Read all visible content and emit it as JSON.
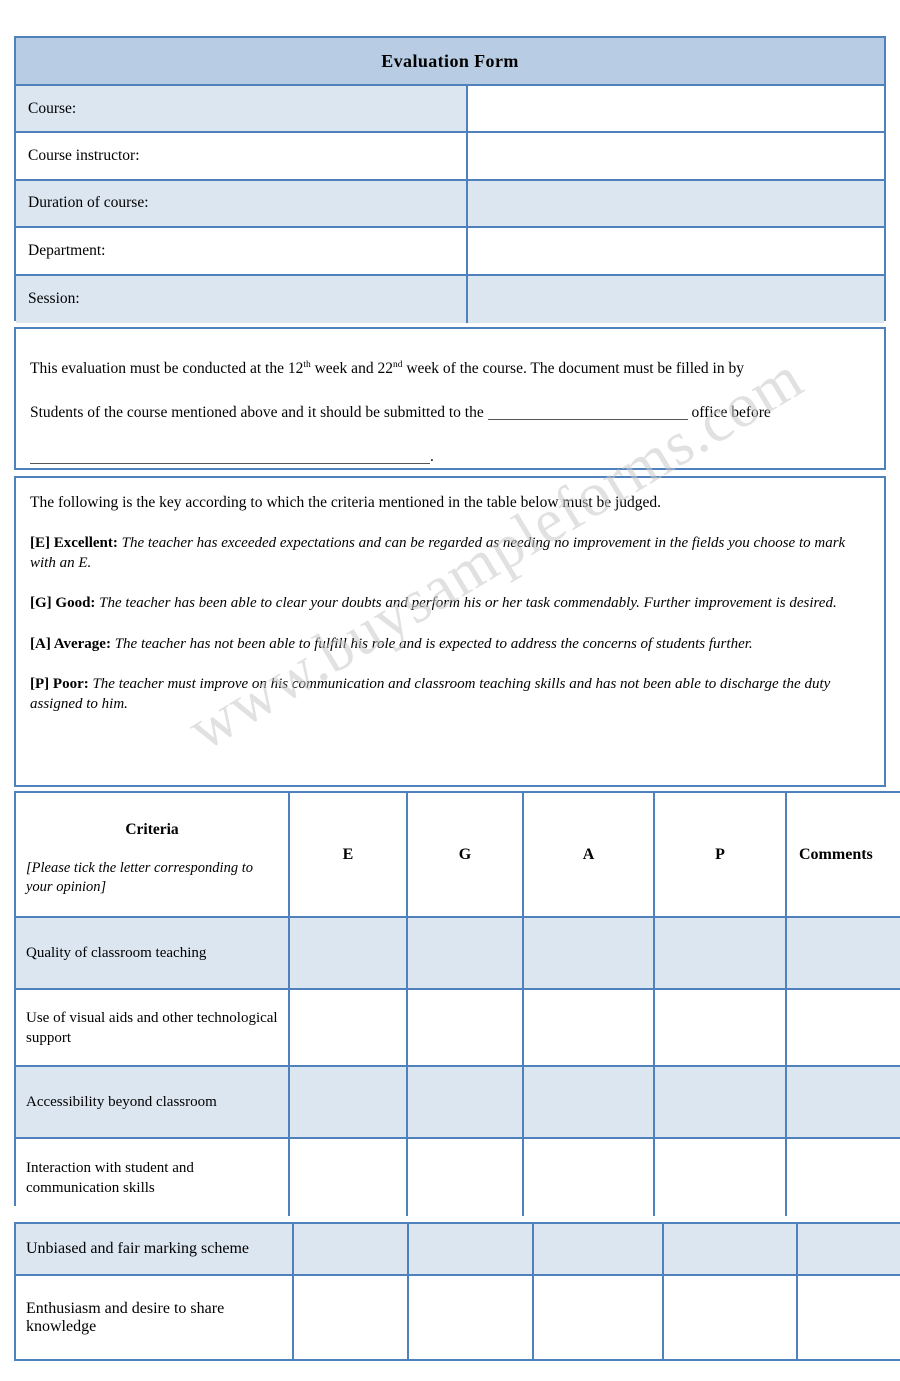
{
  "document": {
    "title": "Evaluation Form",
    "watermark": "www.buysampleforms.com"
  },
  "header_fields": [
    {
      "label": "Course:",
      "value": ""
    },
    {
      "label": "Course instructor:",
      "value": ""
    },
    {
      "label": "Duration of course:",
      "value": ""
    },
    {
      "label": "Department:",
      "value": ""
    },
    {
      "label": "Session:",
      "value": ""
    }
  ],
  "instructions": {
    "line1_a": "This evaluation must be conducted at the 12",
    "line1_sup1": "th",
    "line1_b": " week and 22",
    "line1_sup2": "nd",
    "line1_c": " week of the course. The document must be filled in by",
    "line2_a": "Students of the course mentioned above and it should be submitted to the",
    "line2_b": "office before",
    "line3_end": "."
  },
  "key": {
    "intro": "The following is the key according to which the criteria mentioned in the table below must be judged.",
    "items": [
      {
        "head": "[E] Excellent:",
        "text": "The teacher has exceeded expectations and can be regarded as needing no improvement in the fields you choose to mark with an E."
      },
      {
        "head": "[G] Good:",
        "text": "The teacher has been able to clear your doubts and perform his or her task commendably. Further improvement is desired."
      },
      {
        "head": "[A] Average:",
        "text": "The teacher has not been able to fulfill his role and is expected to address the concerns of students further."
      },
      {
        "head": "[P] Poor:",
        "text": "The teacher must improve on his communication and classroom teaching skills and has not been able to discharge the duty assigned to him."
      }
    ]
  },
  "criteria_table": {
    "header": {
      "criteria_title": "Criteria",
      "criteria_sub": "[Please tick the letter corresponding to your opinion]",
      "col_e": "E",
      "col_g": "G",
      "col_a": "A",
      "col_p": "P",
      "col_comments": "Comments"
    },
    "rows": [
      {
        "criteria": "Quality of classroom teaching",
        "e": "",
        "g": "",
        "a": "",
        "p": "",
        "comments": ""
      },
      {
        "criteria": "Use of visual aids and other technological support",
        "e": "",
        "g": "",
        "a": "",
        "p": "",
        "comments": ""
      },
      {
        "criteria": "Accessibility beyond classroom",
        "e": "",
        "g": "",
        "a": "",
        "p": "",
        "comments": ""
      },
      {
        "criteria": "Interaction with student and communication skills",
        "e": "",
        "g": "",
        "a": "",
        "p": "",
        "comments": ""
      }
    ]
  },
  "criteria_table_2": {
    "rows": [
      {
        "criteria": "Unbiased and fair marking scheme",
        "e": "",
        "g": "",
        "a": "",
        "p": "",
        "comments": ""
      },
      {
        "criteria": "Enthusiasm and desire to share knowledge",
        "e": "",
        "g": "",
        "a": "",
        "p": "",
        "comments": ""
      }
    ]
  },
  "colors": {
    "border": "#4f81bd",
    "title_fill": "#b8cce4",
    "row_shade": "#dce6f1",
    "row_plain": "#ffffff",
    "watermark": "#c9c9c9"
  }
}
